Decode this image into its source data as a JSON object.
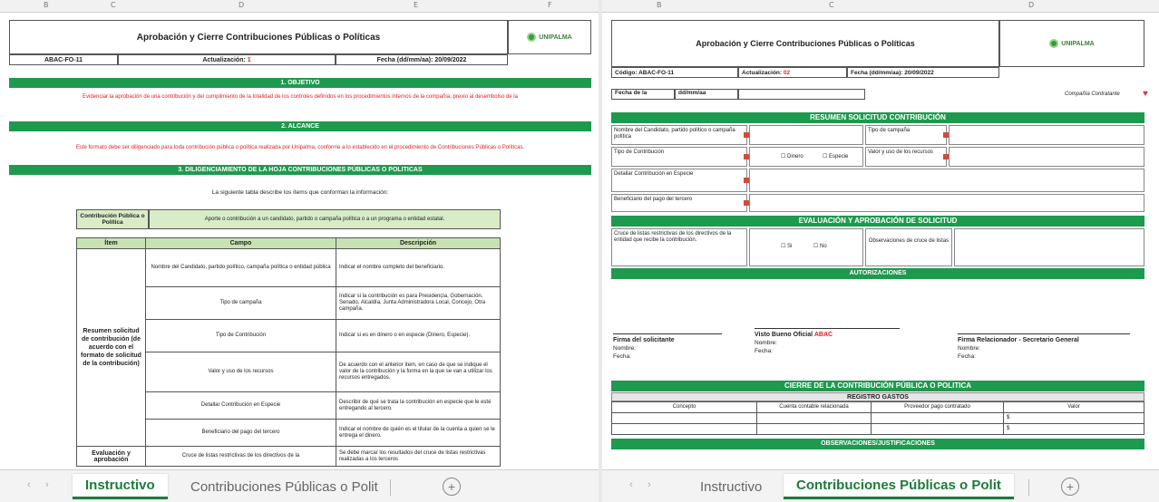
{
  "left_sheet": {
    "column_letters": [
      "B",
      "C",
      "D",
      "E",
      "F"
    ],
    "title": "Aprobación y Cierre Contribuciones Públicas o Políticas",
    "logo_text": "UNIPALMA",
    "code": "ABAC-FO-11",
    "version_label": "Actualización:",
    "version_value": "1",
    "date_label": "Fecha (dd/mm/aa): 20/09/2022",
    "section1": "1. OBJETIVO",
    "section1_text": "Evidenciar la aprobación de una contribución y del cumplimiento de la totalidad de los controles definidos en los procedimientos internos de la compañía, previo al desembolso de la",
    "section2": "2. ALCANCE",
    "section2_text": "Este formato debe ser diligenciado para toda contribución pública o política realizada por Unipalma, conforme a lo establecido en el procedimiento de Contribuciones Públicas o Políticas.",
    "section3": "3. DILIGENCIAMIENTO DE LA HOJA CONTRIBUCIONES PÚBLICAS O POLITICAS",
    "section3_intro": "La siguiente tabla describe los ítems que conforman la información:",
    "def_term": "Contribución Pública o Política",
    "def_text": "Aporte o contribución a un candidato, partido o campaña política o a un programa o entidad estatal.",
    "table_headers": [
      "Ítem",
      "Campo",
      "Descripción"
    ],
    "group1": "Resumen solicitud de contribución (de acuerdo con el formato de solicitud de la contribución)",
    "rows": [
      {
        "campo": "Nombre del Candidato, partido político, campaña política o entidad pública",
        "desc": "Indicar el nombre completo del beneficiario."
      },
      {
        "campo": "Tipo de campaña",
        "desc": "Indicar si la contribución es para Presidencia, Gobernación, Senado, Alcaldía, Junta Administradora Local, Concejo, Otra campaña."
      },
      {
        "campo": "Tipo de Contribución",
        "desc": "Indicar si es en dinero o en especie (Dinero, Especie)."
      },
      {
        "campo": "Valor y uso de los recursos",
        "desc": "De acuerdo con el anterior ítem, en caso de que se indique el valor de la contribución y la forma en la que se van a utilizar los recursos entregados."
      },
      {
        "campo": "Detallar Contribución en Especie",
        "desc": "Describir de qué se trata la contribución en especie que le esté entregando al tercero."
      },
      {
        "campo": "Beneficiario del pago del tercero",
        "desc": "Indicar el nombre de quién es el titular de la cuenta a quien se le entrega el dinero."
      }
    ],
    "group2": "Evaluación y aprobación",
    "group2_campo": "Cruce de listas restrictivas de los directivos de la",
    "group2_desc": "Se debe marcar los resultados del cruce de listas restrictivas realizadas a los terceros"
  },
  "right_sheet": {
    "column_letters": [
      "B",
      "C",
      "D"
    ],
    "title": "Aprobación y Cierre Contribuciones Públicas o Políticas",
    "logo_text": "UNIPALMA",
    "code": "Código: ABAC-FO-11",
    "version_label": "Actualización:",
    "version_value": "02",
    "date_label": "Fecha (dd/mm/aa): 20/09/2022",
    "date_row_label": "Fecha de la",
    "date_row_value": "dd/mm/aa",
    "compliance_label": "Compañía Contratante",
    "resumen_title": "RESUMEN SOLICITUD CONTRIBUCIÓN",
    "resumen_fields": {
      "candidate": "Nombre del Candidato, partido político o campaña política",
      "campaign_type": "Tipo de campaña",
      "contribution_type": "Tipo de Contribución",
      "dinero": "Dinero",
      "especie": "Especie",
      "valor_uso": "Valor y uso de los recursos",
      "detallar": "Detallar Contribución en Especie",
      "beneficiario": "Beneficiario del pago del tercero"
    },
    "evaluacion_title": "EVALUACIÓN Y APROBACIÓN DE SOLICITUD",
    "cruce_label": "Cruce de listas restrictivas de los directivos de la entidad que recibe la contribución.",
    "si": "Si",
    "no": "No",
    "observaciones_label": "Observaciones de cruce de listas",
    "autorizaciones_title": "AUTORIZACIONES",
    "signatures": [
      {
        "title": "Firma del solicitante",
        "highlight": "",
        "nombre": "Nombre:",
        "fecha": "Fecha:"
      },
      {
        "title": "Visto Bueno Oficial",
        "highlight": "ABAC",
        "nombre": "Nombre:",
        "fecha": "Fecha:"
      },
      {
        "title": "Firma Relacionador - Secretario General",
        "highlight": "",
        "nombre": "Nombre:",
        "fecha": "Fecha:"
      }
    ],
    "cierre_title": "CIERRE DE LA CONTRIBUCIÓN PÚBLICA O POLITICA",
    "registro_title": "REGISTRO GASTOS",
    "registro_headers": [
      "Concepto",
      "Cuenta contable relacionada",
      "Proveedor pago contratado",
      "Valor"
    ],
    "currency": "$",
    "observaciones_title": "OBSERVACIONES/JUSTIFICACIONES"
  },
  "left_tabs": {
    "active": "Instructivo",
    "inactive": "Contribuciones Públicas o Polit"
  },
  "right_tabs": {
    "inactive": "Instructivo",
    "active": "Contribuciones Públicas o Polit"
  },
  "add_sheet": "+",
  "colors": {
    "accent": "#1d9a4e",
    "tab_active": "#1e7a3c",
    "required": "#d24a3a"
  }
}
